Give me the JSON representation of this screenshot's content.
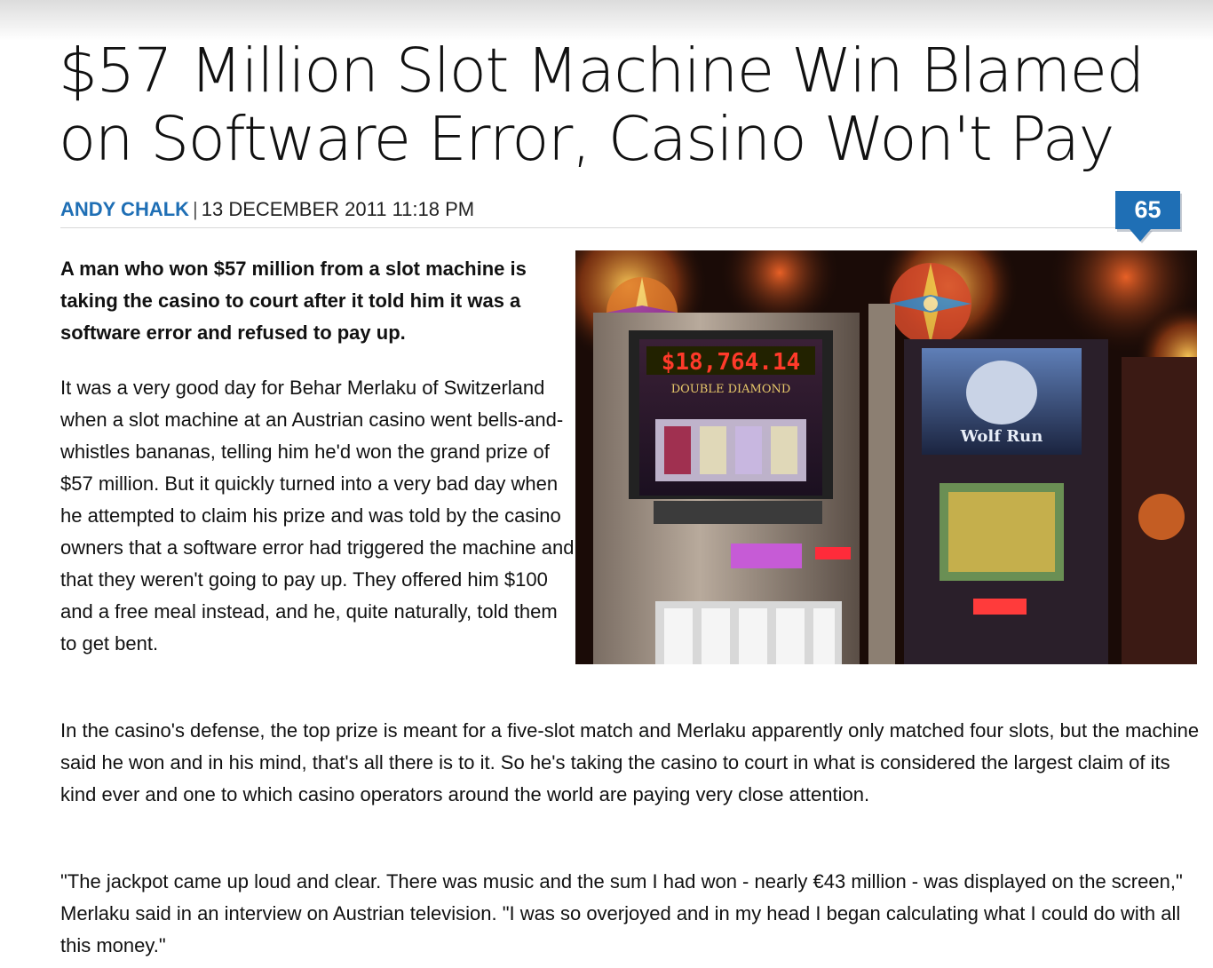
{
  "article": {
    "title": "$57 Million Slot Machine Win Blamed on Software Error, Casino Won't Pay",
    "author": "ANDY CHALK",
    "separator": "|",
    "date": "13 DECEMBER 2011 11:18 PM",
    "comment_count": "65",
    "lede": "A man who won $57 million from a slot machine is taking the casino to court after it told him it was a software error and refused to pay up.",
    "paragraphs": [
      "It was a very good day for Behar Merlaku of Switzerland when a slot machine at an Austrian casino went bells-and-whistles bananas, telling him he'd won the grand prize of $57 million. But it quickly turned into a very bad day when he attempted to claim his prize and was told by the casino owners that a software error had triggered the machine and that they weren't going to pay up. They offered him $100 and a free meal instead, and he, quite naturally, told them to get bent.",
      "In the casino's defense, the top prize is meant for a five-slot match and Merlaku apparently only matched four slots, but the machine said he won and in his mind, that's all there is to it. So he's taking the casino to court in what is considered the largest claim of its kind ever and one to which casino operators around the world are paying very close attention.",
      "\"The jackpot came up loud and clear. There was music and the sum I had won - nearly €43 million - was displayed on the screen,\" Merlaku said in an interview on Austrian television. \"I was so overjoyed and in my head I began calculating what I could do with all this money.\""
    ]
  },
  "photo": {
    "display_amount": "$18,764.14",
    "machine_name": "DOUBLE DIAMOND",
    "side_machine_name": "Wolf Run"
  },
  "colors": {
    "accent": "#1f6fb5",
    "text": "#111111"
  }
}
